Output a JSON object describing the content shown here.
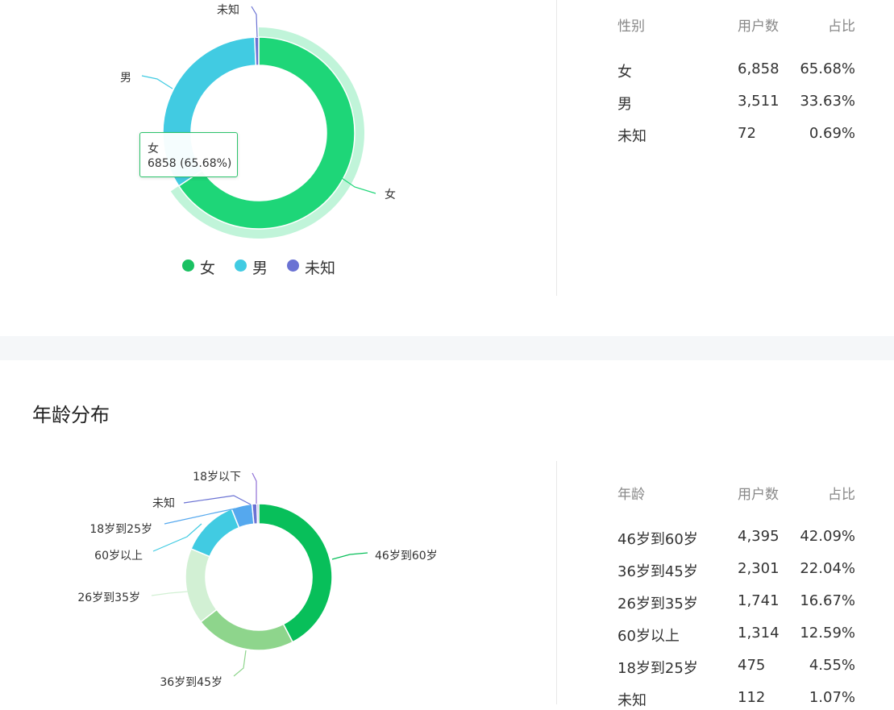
{
  "gender": {
    "table": {
      "headers": [
        "性别",
        "用户数",
        "占比"
      ],
      "rows": [
        {
          "label": "女",
          "count": "6,858",
          "pct": "65.68%"
        },
        {
          "label": "男",
          "count": "3,511",
          "pct": "33.63%"
        },
        {
          "label": "未知",
          "count": "72",
          "pct": "0.69%"
        }
      ]
    },
    "tooltip": {
      "label": "女",
      "value": "6858 (65.68%)"
    }
  },
  "age": {
    "title": "年龄分布",
    "table": {
      "headers": [
        "年龄",
        "用户数",
        "占比"
      ],
      "rows": [
        {
          "label": "46岁到60岁",
          "count": "4,395",
          "pct": "42.09%"
        },
        {
          "label": "36岁到45岁",
          "count": "2,301",
          "pct": "22.04%"
        },
        {
          "label": "26岁到35岁",
          "count": "1,741",
          "pct": "16.67%"
        },
        {
          "label": "60岁以上",
          "count": "1,314",
          "pct": "12.59%"
        },
        {
          "label": "18岁到25岁",
          "count": "475",
          "pct": "4.55%"
        },
        {
          "label": "未知",
          "count": "112",
          "pct": "1.07%"
        }
      ]
    }
  },
  "chart_data": [
    {
      "type": "pie",
      "variant": "donut",
      "categories": [
        "女",
        "男",
        "未知"
      ],
      "values": [
        6858,
        3511,
        72
      ],
      "colors": [
        "#1ed678",
        "#41cbe2",
        "#6a72d3"
      ],
      "legend": "bottom",
      "highlighted": "女"
    },
    {
      "type": "pie",
      "variant": "donut",
      "categories": [
        "46岁到60岁",
        "36岁到45岁",
        "26岁到35岁",
        "60岁以上",
        "18岁到25岁",
        "未知",
        "18岁以下"
      ],
      "values": [
        4395,
        2301,
        1741,
        1314,
        475,
        112,
        40
      ],
      "colors": [
        "#08bf5a",
        "#8ed58c",
        "#d2f0d4",
        "#41cbe2",
        "#55a8ee",
        "#6a72d3",
        "#8f6fd6"
      ],
      "legend": "none"
    }
  ]
}
